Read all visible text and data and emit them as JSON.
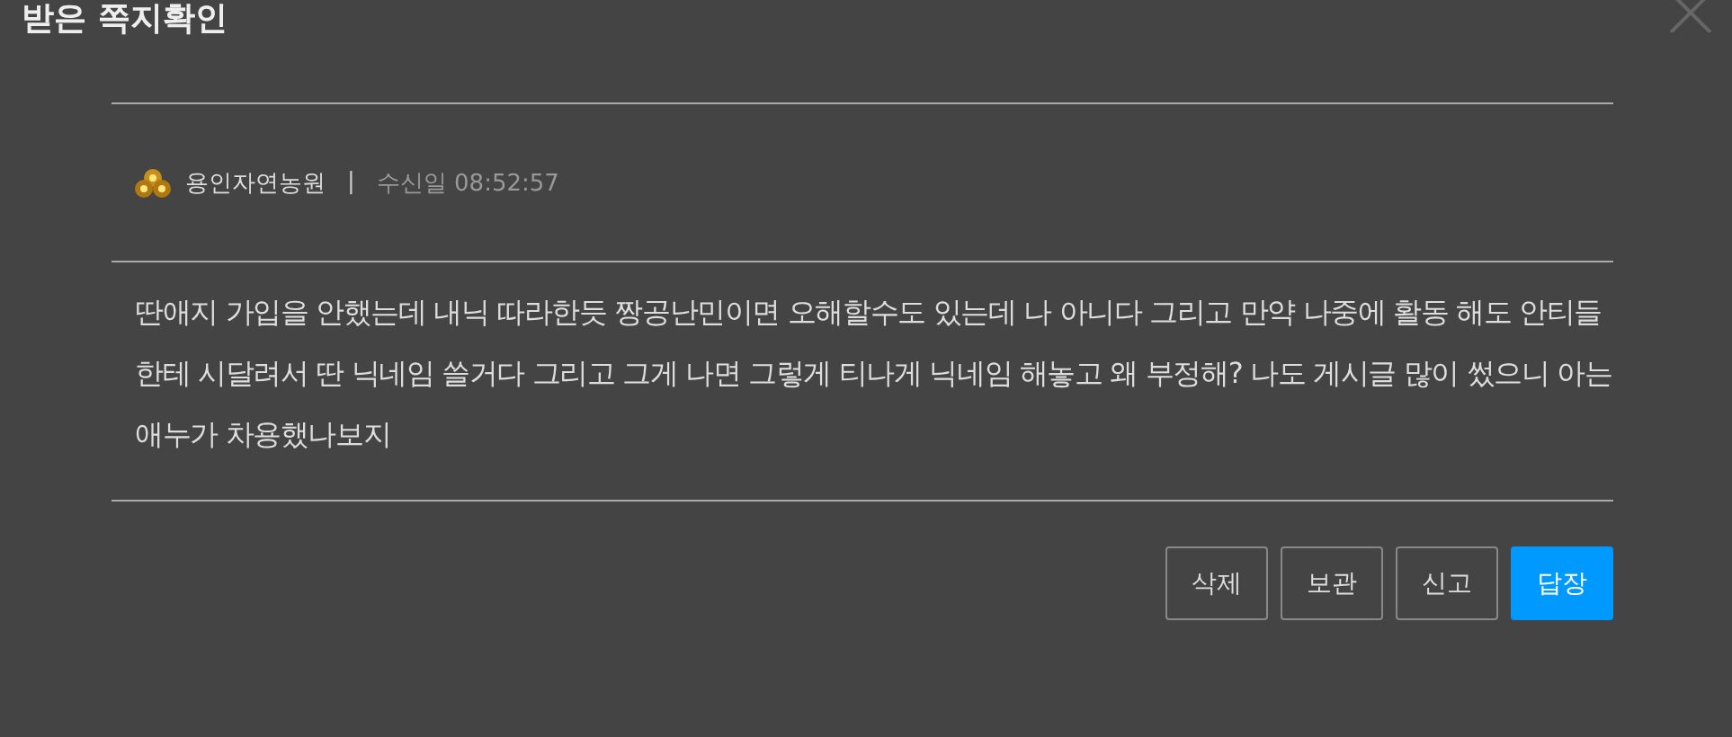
{
  "window": {
    "title": "받은 쪽지확인"
  },
  "message": {
    "sender": "용인자연농원",
    "separator": "|",
    "received": "수신일 08:52:57",
    "body": "딴애지 가입을 안했는데 내닉 따라한듯 짱공난민이면 오해할수도 있는데 나 아니다 그리고 만약 나중에 활동 해도 안티들 한테 시달려서 딴 닉네임 쓸거다 그리고 그게 나면 그렇게 티나게 닉네임 해놓고 왜 부정해? 나도 게시글 많이 썼으니 아는애누가 차용했나보지"
  },
  "buttons": [
    {
      "label": "삭제",
      "kind": "default"
    },
    {
      "label": "보관",
      "kind": "default"
    },
    {
      "label": "신고",
      "kind": "default"
    },
    {
      "label": "답장",
      "kind": "primary"
    }
  ]
}
